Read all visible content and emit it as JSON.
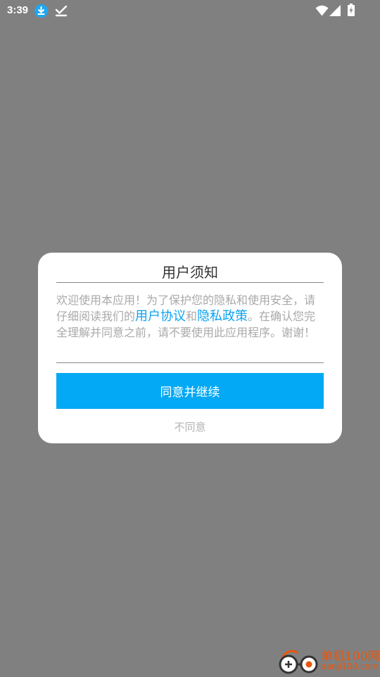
{
  "status_bar": {
    "time": "3:39",
    "icons": [
      "download-icon",
      "check-icon",
      "wifi-icon",
      "signal-icon",
      "battery-icon"
    ]
  },
  "dialog": {
    "title": "用户须知",
    "body": {
      "part1": "欢迎使用本应用！为了保护您的隐私和使用安全，请仔细阅读我们的",
      "link_user_agreement": "用户协议",
      "conjunction": "和",
      "link_privacy_policy": "隐私政策",
      "part2": "。在确认您完全理解并同意之前，请不要使用此应用程序。谢谢！"
    },
    "agree_label": "同意并继续",
    "decline_label": "不同意"
  },
  "watermark": {
    "name": "单机100网",
    "domain": "danji100.com"
  },
  "colors": {
    "overlay": "#808080",
    "accent": "#03a9f4",
    "link": "#0aa3f0",
    "body_text": "#a9a9a9"
  }
}
